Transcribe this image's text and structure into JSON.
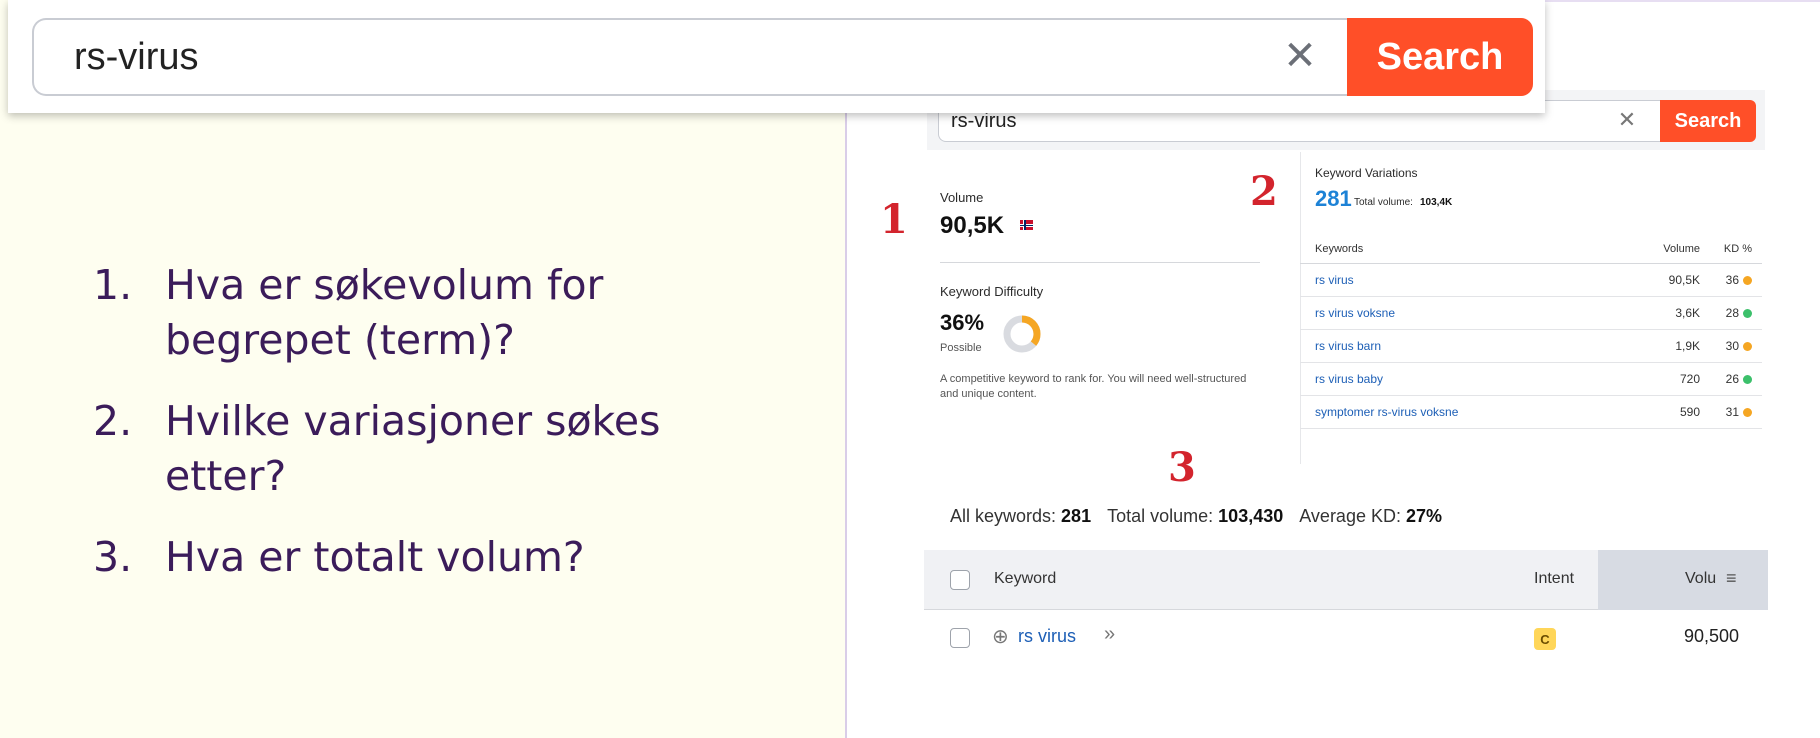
{
  "zoom_search": {
    "query": "rs-virus",
    "clear_glyph": "✕",
    "button_label": "Search"
  },
  "questions": [
    {
      "num": "1.",
      "text": "Hva er søkevolum for begrepet (term)?"
    },
    {
      "num": "2.",
      "text": "Hvilke variasjoner søkes etter?"
    },
    {
      "num": "3.",
      "text": "Hva er totalt volum?"
    }
  ],
  "markers": {
    "one": "1",
    "two": "2",
    "three": "3"
  },
  "panel_search": {
    "query": "rs-virus",
    "clear_glyph": "✕",
    "button_label": "Search"
  },
  "volume": {
    "label": "Volume",
    "value": "90,5K"
  },
  "difficulty": {
    "label": "Keyword Difficulty",
    "value": "36%",
    "level": "Possible",
    "percent": 36,
    "description": "A competitive keyword to rank for. You will need well-structured and unique content."
  },
  "variations": {
    "label": "Keyword Variations",
    "count": "281",
    "total_label": "Total volume:",
    "total_value": "103,4K",
    "columns": {
      "keyword": "Keywords",
      "volume": "Volume",
      "kd": "KD %"
    },
    "rows": [
      {
        "keyword": "rs virus",
        "volume": "90,5K",
        "kd": "36",
        "kd_color": "#f5a623"
      },
      {
        "keyword": "rs virus voksne",
        "volume": "3,6K",
        "kd": "28",
        "kd_color": "#3cc06b"
      },
      {
        "keyword": "rs virus barn",
        "volume": "1,9K",
        "kd": "30",
        "kd_color": "#f5a623"
      },
      {
        "keyword": "rs virus baby",
        "volume": "720",
        "kd": "26",
        "kd_color": "#3cc06b"
      },
      {
        "keyword": "symptomer rs-virus voksne",
        "volume": "590",
        "kd": "31",
        "kd_color": "#f5a623"
      }
    ]
  },
  "summary": {
    "all_label": "All keywords:",
    "all_value": "281",
    "total_label": "Total volume:",
    "total_value": "103,430",
    "kd_label": "Average KD:",
    "kd_value": "27%"
  },
  "table": {
    "col_keyword": "Keyword",
    "col_intent": "Intent",
    "col_volume": "Volu",
    "sort_glyph": "≡",
    "row": {
      "keyword": "rs virus",
      "add_glyph": "⊕",
      "expand_glyph": "»",
      "intent": "C",
      "volume": "90,500"
    }
  },
  "colors": {
    "accent": "#ff4f28",
    "link": "#1d5fb6",
    "marker": "#d3242d",
    "question_text": "#3b1c5a",
    "slide_bg": "#fefef0"
  }
}
